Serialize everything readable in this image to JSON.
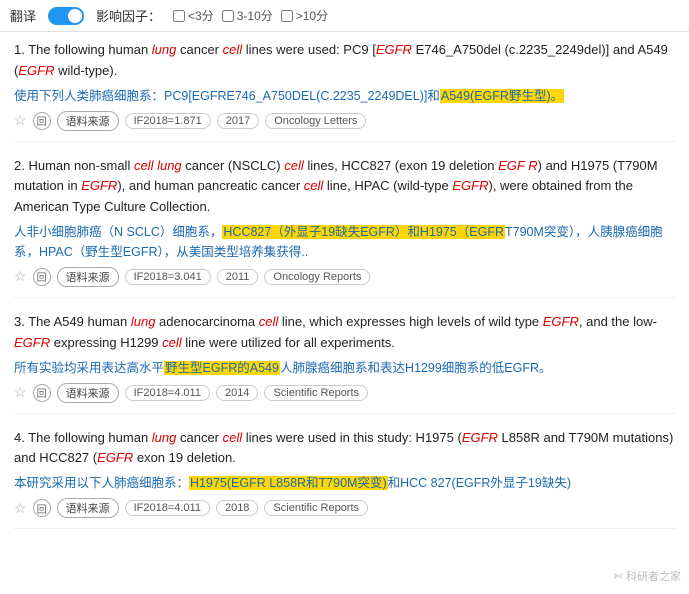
{
  "topbar": {
    "translate_label": "翻译",
    "impact_label": "影响因子：",
    "filters": [
      {
        "label": "<3分",
        "checked": false
      },
      {
        "label": "3-10分",
        "checked": false
      },
      {
        ">10分": ">10分",
        "label": ">10分",
        "checked": false
      }
    ]
  },
  "results": [
    {
      "number": "1.",
      "en_html": "The following human <em>lung</em> cancer <em>cell</em> lines were used: PC9 [<em>EGFR</em> E746_A750del (c.2235_2249del)] and A549 (<em>EGFR</em> wild-type).",
      "cn_html": "使用下列人类肺癌细胞系：PC9[EGFRE746_A750DEL(C.2235_2249DEL)]和<span class='highlight-box'>A549(EGFR野生型)。</span>",
      "meta": {
        "if_label": "IF2018=1.871",
        "year": "2017",
        "journal": "Oncology Letters"
      }
    },
    {
      "number": "2.",
      "en_html": "Human non-small <em>cell lung</em> cancer (NSCLC) <em>cell</em> lines, HCC827 (exon 19 deletion <em>EGF R</em>) and H1975 (T790M mutation in <em>EGFR</em>), and human pancreatic cancer <em>cell</em> line, HPAC (wild-type <em>EGFR</em>), were obtained from the American Type Culture Collection.",
      "cn_html": "人非小细胞肺癌（N SCLC）细胞系，<span class='highlight-box'>HCC827（外显子19缺失EGFR）和H1975（EGFR</span>T790M突变），人胰腺癌细胞系，HPAC（野生型EGFR），从美国类型培养集获得..",
      "meta": {
        "if_label": "IF2018=3.041",
        "year": "2011",
        "journal": "Oncology Reports"
      }
    },
    {
      "number": "3.",
      "en_html": "The A549 human <em>lung</em> adenocarcinoma <em>cell</em> line, which expresses high levels of wild type <em>EGFR</em>, and the low-<em>EGFR</em> expressing H1299 <em>cell</em> line were utilized for all experiments.",
      "cn_html": "所有实验均采用表达高水平<span class='highlight-box'>野生型EGFR的A549</span>人肺腺癌细胞系和表达H1299细胞系的低EGFR。",
      "meta": {
        "if_label": "IF2018=4.011",
        "year": "2014",
        "journal": "Scientific Reports"
      }
    },
    {
      "number": "4.",
      "en_html": "The following human <em>lung</em> cancer <em>cell</em> lines were used in this study: H1975 (<em>EGFR</em> L858R and T790M mutations) and HCC827 (<em>EGFR</em> exon 19 deletion.",
      "cn_html": "本研究采用以下人肺癌细胞系：<span class='highlight-box'>H1975(EGFR L858R和T790M突变)</span>和HCC 827(EGFR外显子19缺失)",
      "meta": {
        "if_label": "IF2018=4.011",
        "year": "2018",
        "journal": "Scientific Reports"
      }
    }
  ],
  "watermark": "科研者之家",
  "labels": {
    "source": "语料来源",
    "star": "☆",
    "circle": "回"
  }
}
